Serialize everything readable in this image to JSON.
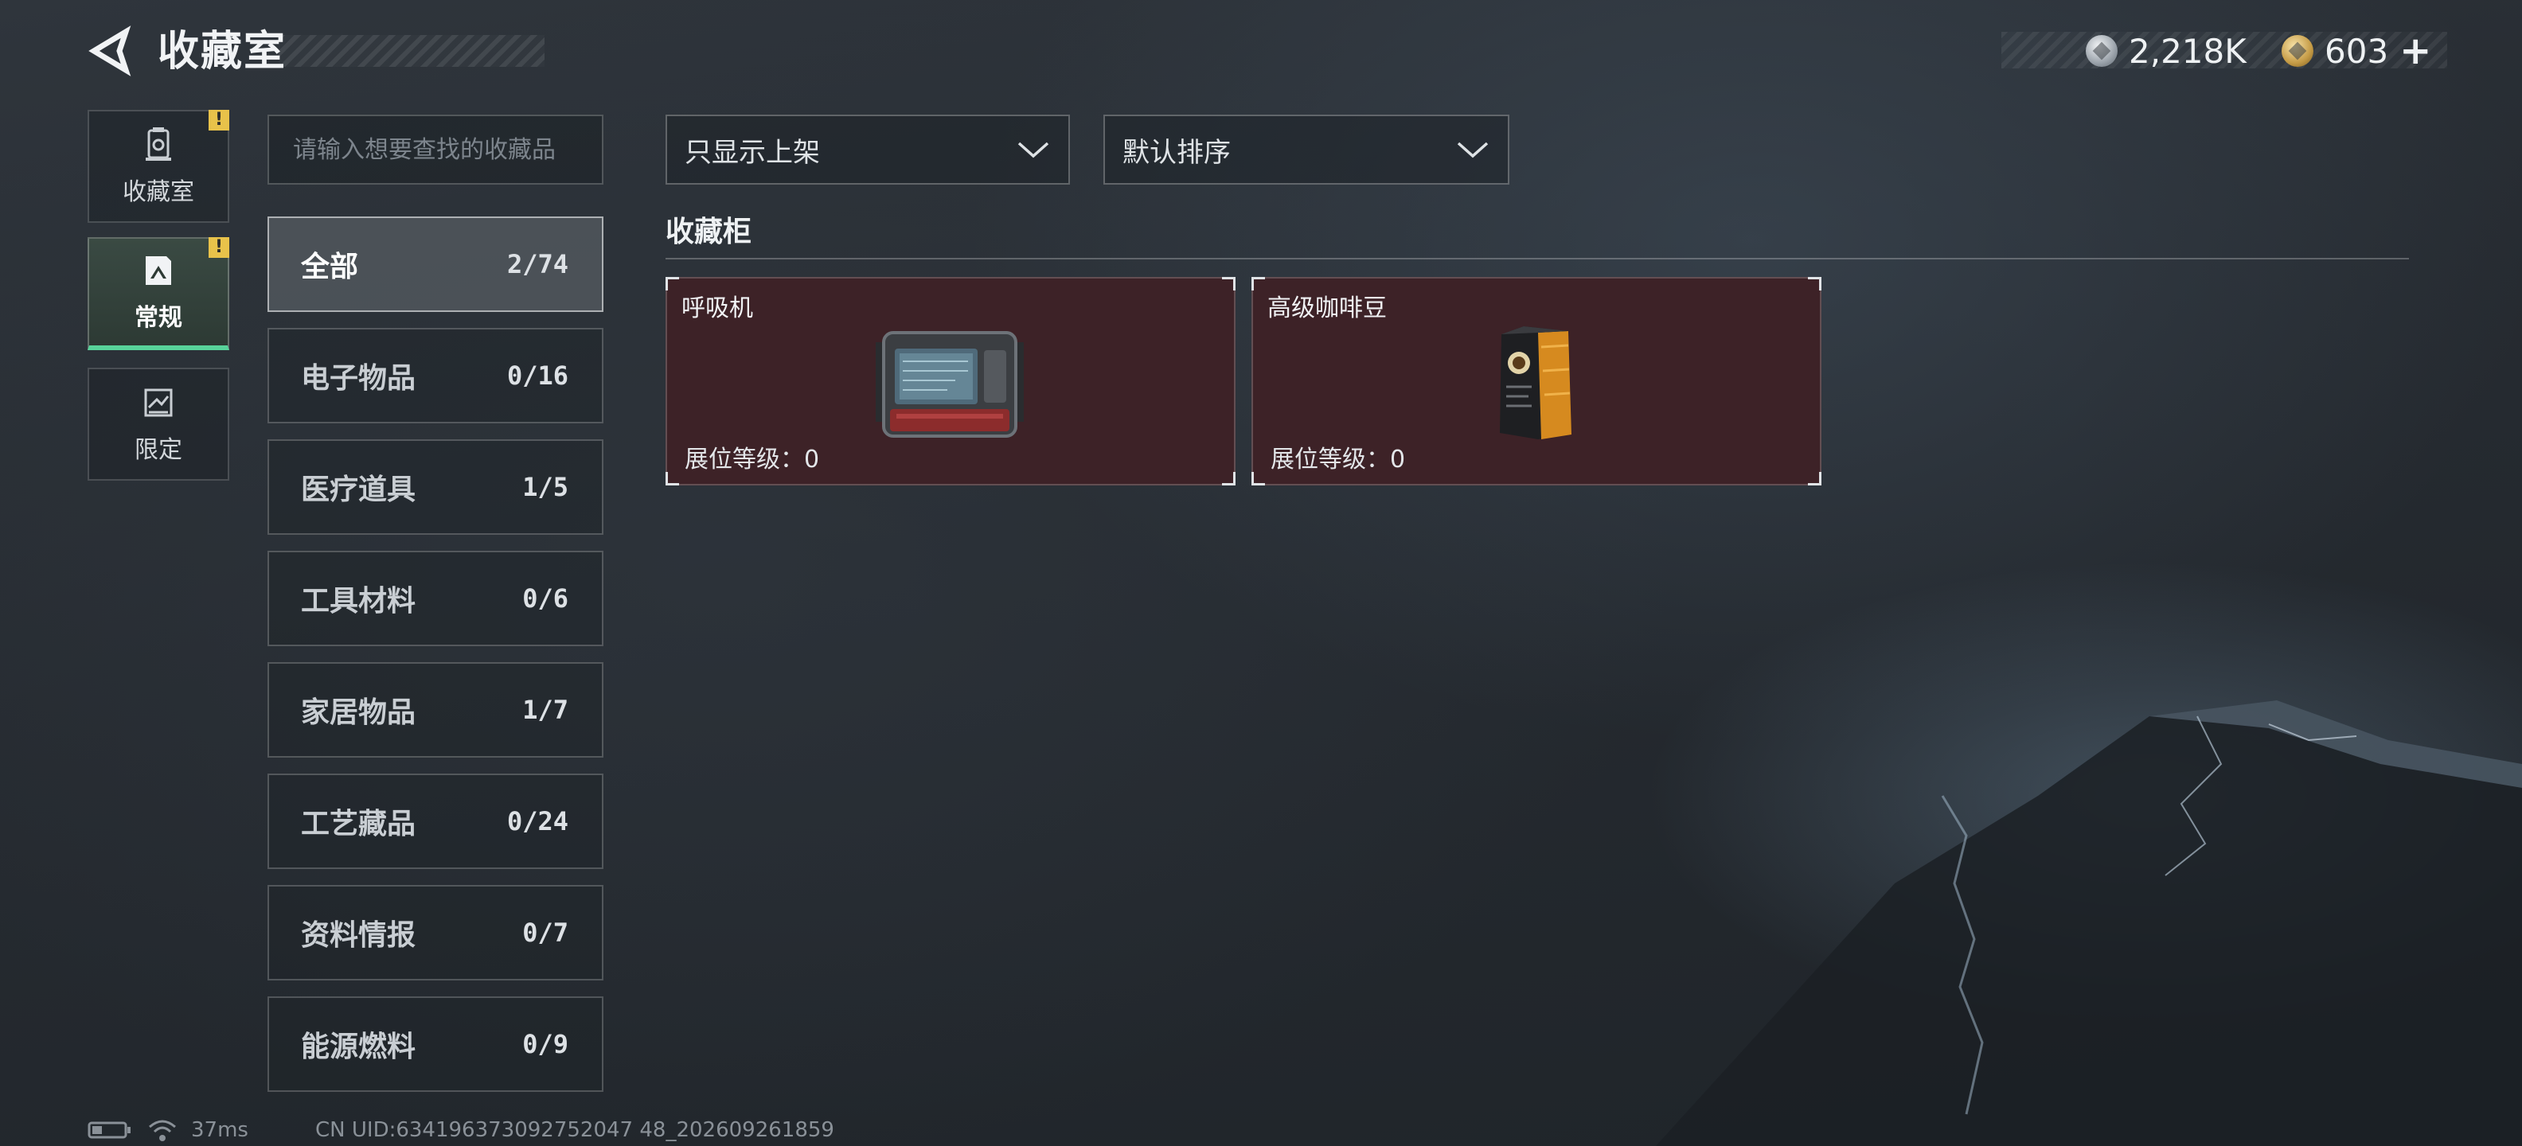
{
  "header": {
    "title": "收藏室"
  },
  "currency": [
    {
      "icon": "silver-coin-icon",
      "value": "2,218K"
    },
    {
      "icon": "gold-coin-icon",
      "value": "603"
    }
  ],
  "nav": [
    {
      "label": "收藏室",
      "icon": "collection-room-icon",
      "alert": "!",
      "active": false
    },
    {
      "label": "常规",
      "icon": "regular-icon",
      "alert": "!",
      "active": true
    },
    {
      "label": "限定",
      "icon": "limited-icon",
      "active": false
    }
  ],
  "search": {
    "placeholder": "请输入想要查找的收藏品"
  },
  "categories": [
    {
      "name": "全部",
      "count": "2/74",
      "active": true
    },
    {
      "name": "电子物品",
      "count": "0/16"
    },
    {
      "name": "医疗道具",
      "count": "1/5"
    },
    {
      "name": "工具材料",
      "count": "0/6"
    },
    {
      "name": "家居物品",
      "count": "1/7"
    },
    {
      "name": "工艺藏品",
      "count": "0/24"
    },
    {
      "name": "资料情报",
      "count": "0/7"
    },
    {
      "name": "能源燃料",
      "count": "0/9"
    }
  ],
  "filters": {
    "display": {
      "value": "只显示上架"
    },
    "sort": {
      "value": "默认排序"
    }
  },
  "section": {
    "title": "收藏柜"
  },
  "items": [
    {
      "name": "呼吸机",
      "level": "展位等级：0",
      "icon": "ventilator-icon"
    },
    {
      "name": "高级咖啡豆",
      "level": "展位等级：0",
      "icon": "coffee-bag-icon"
    }
  ],
  "status": {
    "ping": "37ms",
    "uid": "CN UID:634196373092752047 48_202609261859"
  },
  "colors": {
    "accent": "#58d39a",
    "alert": "#e8c24a",
    "card_bg": "#3d2227"
  }
}
